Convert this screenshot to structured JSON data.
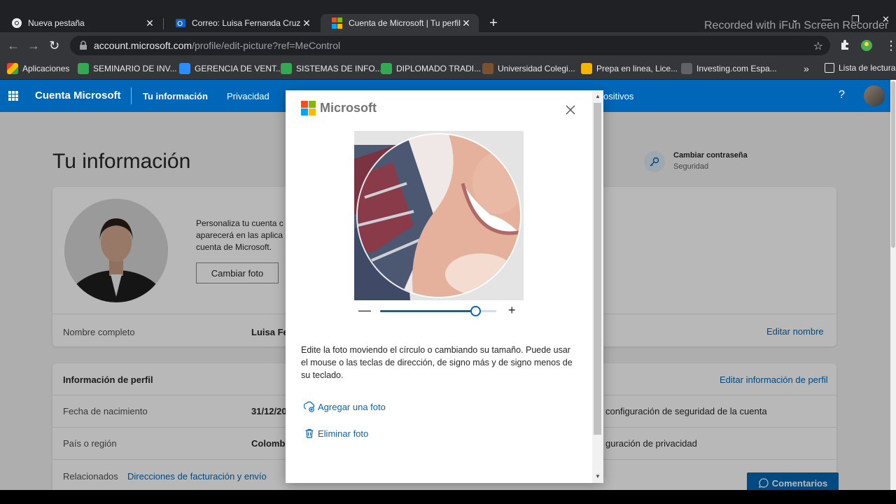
{
  "browser": {
    "tabs": [
      {
        "title": "Nueva pestaña",
        "active": false
      },
      {
        "title": "Correo: Luisa Fernanda Cruz Vasa",
        "active": false
      },
      {
        "title": "Cuenta de Microsoft | Tu perfil",
        "active": true
      }
    ],
    "new_tab_glyph": "+",
    "watermark": "Recorded with iFun Screen Recorder",
    "url_host": "account.microsoft.com",
    "url_path": "/profile/edit-picture?ref=MeControl",
    "bookmarks": [
      {
        "label": "Aplicaciones",
        "color": "#ea4335"
      },
      {
        "label": "SEMINARIO DE INV...",
        "color": "#34a853"
      },
      {
        "label": "GERENCIA DE VENT...",
        "color": "#2d8cff"
      },
      {
        "label": "SISTEMAS DE INFO...",
        "color": "#34a853"
      },
      {
        "label": "DIPLOMADO TRADI...",
        "color": "#34a853"
      },
      {
        "label": "Universidad Colegi...",
        "color": "#e8eaed"
      },
      {
        "label": "Prepa en linea, Lice...",
        "color": "#f4b400"
      },
      {
        "label": "Investing.com Espa...",
        "color": "#e8eaed"
      }
    ],
    "bookmarks_more": "»",
    "reading_list": "Lista de lectura"
  },
  "header": {
    "brand": "Cuenta Microsoft",
    "nav": [
      "Tu información",
      "Privacidad",
      "ositivos"
    ],
    "help": "?"
  },
  "page": {
    "title": "Tu información",
    "password": {
      "title": "Cambiar contraseña",
      "subtitle": "Seguridad"
    },
    "personalize_text": "Personaliza tu cuenta c aparecerá en las aplica cuenta de Microsoft.",
    "change_photo": "Cambiar foto",
    "full_name_label": "Nombre completo",
    "full_name_value": "Luisa Fer",
    "edit_name": "Editar nombre",
    "profile_info": "Información de perfil",
    "edit_profile": "Editar información de perfil",
    "birth_label": "Fecha de nacimiento",
    "birth_value": "31/12/20",
    "security_link": "configuración de seguridad de la cuenta",
    "country_label": "País o región",
    "country_value": "Colombi",
    "privacy_link": "guración de privacidad",
    "related_label": "Relacionados",
    "billing_link": "Direcciones de facturación y envío",
    "feedback": "Comentarios"
  },
  "dialog": {
    "brand": "Microsoft",
    "zoom_fraction": 0.82,
    "minus": "—",
    "plus": "+",
    "description": "Edite la foto moviendo el círculo o cambiando su tamaño. Puede usar el mouse o las teclas de dirección, de signo más y de signo menos de su teclado.",
    "add_photo": "Agregar una foto",
    "remove_photo": "Eliminar foto"
  },
  "colors": {
    "accent": "#0067b8",
    "ms_red": "#f25022",
    "ms_green": "#7fba00",
    "ms_blue": "#00a4ef",
    "ms_yellow": "#ffb900"
  }
}
